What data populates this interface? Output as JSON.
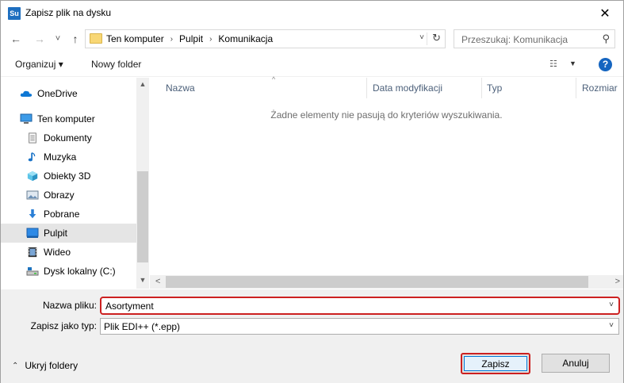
{
  "window": {
    "title": "Zapisz plik na dysku",
    "app_icon_text": "Su",
    "close_symbol": "✕"
  },
  "nav": {
    "back_symbol": "←",
    "forward_symbol": "→",
    "recent_symbol": "˅",
    "up_symbol": "↑",
    "breadcrumbs": [
      "Ten komputer",
      "Pulpit",
      "Komunikacja"
    ],
    "crumb_separator": "›",
    "address_dropdown_symbol": "˅",
    "refresh_symbol": "↻",
    "search_placeholder": "Przeszukaj: Komunikacja",
    "search_symbol": "⚲"
  },
  "toolbar": {
    "organize_label": "Organizuj ▾",
    "new_folder_label": "Nowy folder",
    "view_symbol": "☷",
    "view_dropdown_symbol": "▼",
    "help_symbol": "?"
  },
  "sidebar": {
    "items": [
      {
        "label": "OneDrive",
        "icon": "onedrive-icon"
      },
      {
        "label": "Ten komputer",
        "icon": "computer-icon"
      },
      {
        "label": "Dokumenty",
        "icon": "documents-icon"
      },
      {
        "label": "Muzyka",
        "icon": "music-icon"
      },
      {
        "label": "Obiekty 3D",
        "icon": "objects-3d-icon"
      },
      {
        "label": "Obrazy",
        "icon": "pictures-icon"
      },
      {
        "label": "Pobrane",
        "icon": "downloads-icon"
      },
      {
        "label": "Pulpit",
        "icon": "desktop-icon",
        "selected": true
      },
      {
        "label": "Wideo",
        "icon": "video-icon"
      },
      {
        "label": "Dysk lokalny (C:)",
        "icon": "drive-icon"
      }
    ],
    "scroll_up_symbol": "▲",
    "scroll_down_symbol": "▼"
  },
  "filelist": {
    "columns": [
      "Nazwa",
      "Data modyfikacji",
      "Typ",
      "Rozmiar"
    ],
    "sort_symbol": "^",
    "empty_message": "Żadne elementy nie pasują do kryteriów wyszukiwania.",
    "scroll_left_symbol": "<",
    "scroll_right_symbol": ">"
  },
  "form": {
    "filename_label": "Nazwa pliku:",
    "filename_value": "Asortyment",
    "filetype_label": "Zapisz jako typ:",
    "filetype_value": "Plik EDI++ (*.epp)",
    "dropdown_symbol": "˅"
  },
  "footer": {
    "hide_folders_label": "Ukryj foldery",
    "hide_folders_symbol": "⌃",
    "save_label": "Zapisz",
    "cancel_label": "Anuluj"
  },
  "colors": {
    "accent": "#0078d7",
    "highlight_border": "#cc2020",
    "selected_bg": "#e5e5e5"
  }
}
